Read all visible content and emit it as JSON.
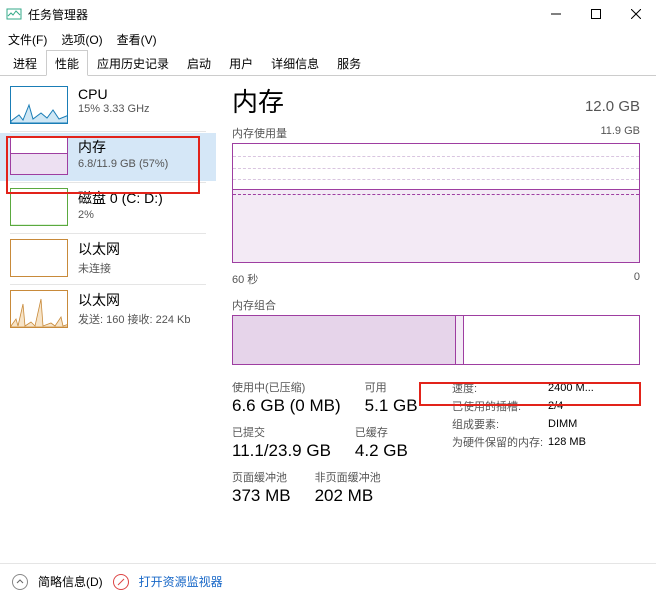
{
  "window": {
    "title": "任务管理器"
  },
  "menu": {
    "file": "文件(F)",
    "options": "选项(O)",
    "view": "查看(V)"
  },
  "tabs": [
    "进程",
    "性能",
    "应用历史记录",
    "启动",
    "用户",
    "详细信息",
    "服务"
  ],
  "sidebar": [
    {
      "title": "CPU",
      "sub": "15%  3.33 GHz"
    },
    {
      "title": "内存",
      "sub": "6.8/11.9 GB (57%)"
    },
    {
      "title": "磁盘 0 (C: D:)",
      "sub": "2%"
    },
    {
      "title": "以太网",
      "sub": "未连接"
    },
    {
      "title": "以太网",
      "sub": "发送: 160  接收: 224 Kb"
    }
  ],
  "header": {
    "title": "内存",
    "total": "12.0 GB"
  },
  "graph1": {
    "label": "内存使用量",
    "max": "11.9 GB",
    "xlabel": "60 秒",
    "xright": "0"
  },
  "graph2": {
    "label": "内存组合"
  },
  "stats": {
    "r1c1_l": "使用中(已压缩)",
    "r1c1_v": "6.6 GB (0 MB)",
    "r1c2_l": "可用",
    "r1c2_v": "5.1 GB",
    "r2c1_l": "已提交",
    "r2c1_v": "11.1/23.9 GB",
    "r2c2_l": "已缓存",
    "r2c2_v": "4.2 GB",
    "r3c1_l": "页面缓冲池",
    "r3c1_v": "373 MB",
    "r3c2_l": "非页面缓冲池",
    "r3c2_v": "202 MB"
  },
  "info": [
    {
      "k": "速度:",
      "v": "2400 M..."
    },
    {
      "k": "已使用的插槽:",
      "v": "2/4"
    },
    {
      "k": "组成要素:",
      "v": "DIMM"
    },
    {
      "k": "为硬件保留的内存:",
      "v": "128 MB"
    }
  ],
  "footer": {
    "less": "简略信息(D)",
    "resmon": "打开资源监视器"
  }
}
